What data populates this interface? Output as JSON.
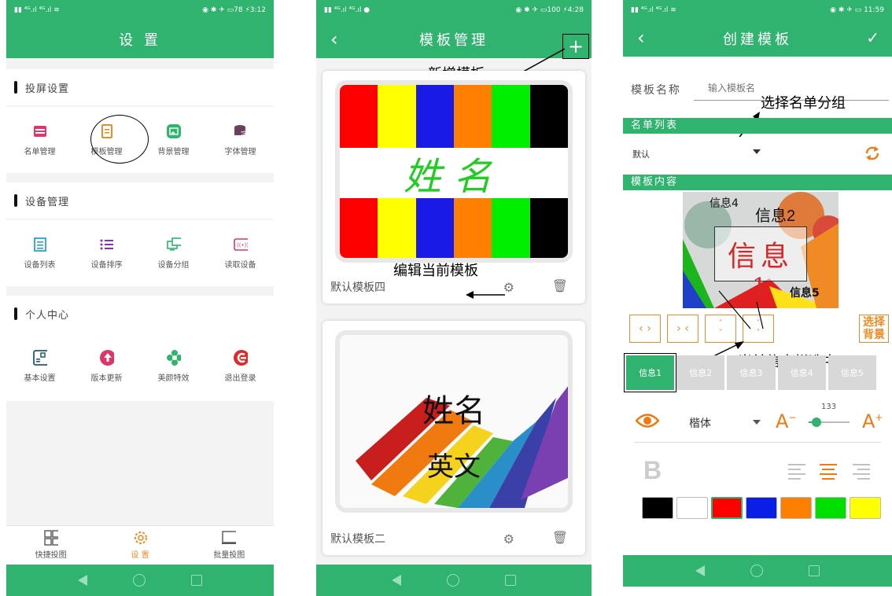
{
  "panel1": {
    "status_time": "3:12",
    "status_battery": "78",
    "title": "设 置",
    "sections": [
      {
        "title": "投屏设置",
        "items": [
          {
            "label": "名单管理",
            "icon": "list-box-icon",
            "color": "#e0356b"
          },
          {
            "label": "模板管理",
            "icon": "document-icon",
            "color": "#f08a24"
          },
          {
            "label": "背景管理",
            "icon": "image-icon",
            "color": "#2fb36e"
          },
          {
            "label": "字体管理",
            "icon": "font-icon",
            "color": "#6b3f5e"
          }
        ]
      },
      {
        "title": "设备管理",
        "items": [
          {
            "label": "设备列表",
            "icon": "device-list-icon",
            "color": "#2ba4c9"
          },
          {
            "label": "设备排序",
            "icon": "sort-list-icon",
            "color": "#8b2db5"
          },
          {
            "label": "设备分组",
            "icon": "monitor-group-icon",
            "color": "#2fb36e"
          },
          {
            "label": "读取设备",
            "icon": "signal-read-icon",
            "color": "#e0356b"
          }
        ]
      },
      {
        "title": "个人中心",
        "items": [
          {
            "label": "基本设置",
            "icon": "settings-box-icon",
            "color": "#1f5a7a"
          },
          {
            "label": "版本更新",
            "icon": "upgrade-icon",
            "color": "#e0356b"
          },
          {
            "label": "美颜特效",
            "icon": "flower-icon",
            "color": "#2fb36e"
          },
          {
            "label": "退出登录",
            "icon": "logout-icon",
            "color": "#e02b2b"
          }
        ]
      }
    ],
    "bottom_tabs": [
      {
        "label": "快捷投图",
        "icon": "grid-icon"
      },
      {
        "label": "设 置",
        "icon": "gear-icon"
      },
      {
        "label": "批量投图",
        "icon": "screen-icon"
      }
    ]
  },
  "panel2": {
    "status_time": "4:28",
    "status_battery": "100",
    "title": "模板管理",
    "add_symbol": "+",
    "annotation_add": "新增模板",
    "annotation_edit": "编辑当前模板",
    "template1_name_text": "姓名",
    "template1_label": "默认模板四",
    "template2_name": "姓名",
    "template2_sub": "英文",
    "template2_label": "默认模板二",
    "stripe_colors": [
      "#ff0000",
      "#ffff00",
      "#1a1ae6",
      "#ff7f00",
      "#00ee00",
      "#000000"
    ]
  },
  "panel3": {
    "status_time": "11:59",
    "title": "创建模板",
    "name_label": "模板名称",
    "name_placeholder": "输入模板名",
    "annotation_group": "选择名单分组",
    "list_header": "名单列表",
    "list_value": "默认",
    "content_header": "模板内容",
    "preview_info4": "信息4",
    "preview_info2": "信息2",
    "preview_info": "信息",
    "preview_one": "1",
    "preview_info5": "信息5",
    "select_bg": "选择背景",
    "annotation_current": "当前信息栏选中",
    "info_tabs": [
      "信息1",
      "信息2",
      "信息3",
      "信息4",
      "信息5"
    ],
    "font_name": "楷体",
    "font_size": "133",
    "font_size_fraction": 0.2,
    "colors": [
      "#000000",
      "#ffffff",
      "#ff0000",
      "#0a1ee6",
      "#ff7f00",
      "#00e000",
      "#ffff00"
    ],
    "bold": "B"
  }
}
